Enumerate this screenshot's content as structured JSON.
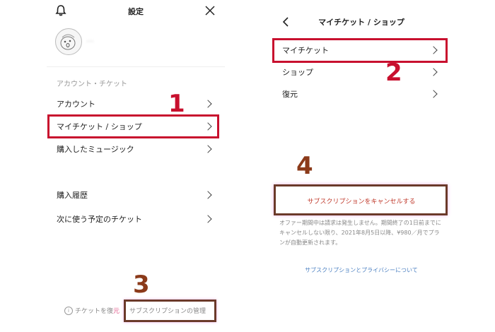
{
  "panel1": {
    "title": "設定",
    "username": "···",
    "section_label": "アカウント・チケット",
    "items": [
      {
        "label": "アカウント"
      },
      {
        "label": "マイチケット / ショップ"
      },
      {
        "label": "購入したミュージック"
      }
    ]
  },
  "panel2": {
    "title": "マイチケット / ショップ",
    "items": [
      {
        "label": "マイチケット"
      },
      {
        "label": "ショップ"
      },
      {
        "label": "復元"
      }
    ]
  },
  "panel3": {
    "items": [
      {
        "label": "購入履歴"
      },
      {
        "label": "次に使う予定のチケット"
      }
    ],
    "restore_prefix": "チケットを復",
    "restore_suffix": "元",
    "manage_sub": "サブスクリプションの管理"
  },
  "panel4": {
    "cancel_label": "サブスクリプションをキャンセルする",
    "notice": "オファー期間中は請求は発生しません。期間終了の1日前までにキャンセルしない限り、2021年8月5日以降、¥980／月でプランが自動更新されます。",
    "link": "サブスクリプションとプライバシーについて"
  },
  "steps": {
    "s1": "1",
    "s2": "2",
    "s3": "3",
    "s4": "4"
  },
  "colors": {
    "step_red": "#c8102e",
    "step_brown": "#8b3a1a",
    "cancel_text": "#c0392b",
    "link": "#4a7fc1"
  }
}
